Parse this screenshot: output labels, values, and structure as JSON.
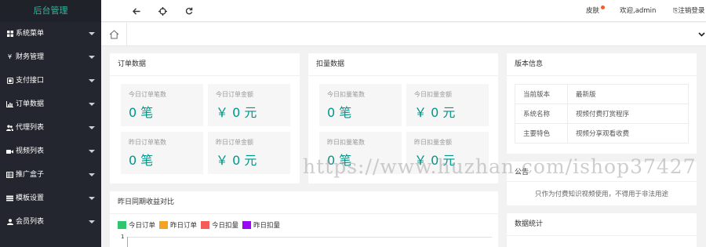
{
  "app": {
    "title": "后台管理"
  },
  "sidebar": {
    "items": [
      {
        "label": "系统菜单",
        "icon": "grid-icon"
      },
      {
        "label": "财务管理",
        "icon": "yen-icon"
      },
      {
        "label": "支付接口",
        "icon": "payment-icon"
      },
      {
        "label": "订单数据",
        "icon": "bar-chart-icon"
      },
      {
        "label": "代理列表",
        "icon": "users-icon"
      },
      {
        "label": "视频列表",
        "icon": "video-icon"
      },
      {
        "label": "推广盒子",
        "icon": "table-icon"
      },
      {
        "label": "模板设置",
        "icon": "layout-icon"
      },
      {
        "label": "会员列表",
        "icon": "user-icon"
      }
    ]
  },
  "header": {
    "skin_label": "皮肤",
    "welcome_text": "欢迎,admin",
    "logout_label": "注销登录"
  },
  "order_card": {
    "title": "订单数据",
    "stats": [
      {
        "label": "今日订单笔数",
        "value": "0 笔"
      },
      {
        "label": "今日订单金额",
        "value": "￥ 0 元"
      },
      {
        "label": "昨日订单笔数",
        "value": "0 笔"
      },
      {
        "label": "昨日订单金额",
        "value": "￥ 0 元"
      }
    ]
  },
  "deduct_card": {
    "title": "扣量数据",
    "stats": [
      {
        "label": "今日扣量笔数",
        "value": "0 笔"
      },
      {
        "label": "今日扣量金额",
        "value": "￥ 0 元"
      },
      {
        "label": "昨日扣量笔数",
        "value": "0 笔"
      },
      {
        "label": "昨日扣量金额",
        "value": "￥ 0 元"
      }
    ]
  },
  "version_card": {
    "title": "版本信息",
    "rows": [
      {
        "key": "当前版本",
        "value": "最新版"
      },
      {
        "key": "系统名称",
        "value": "视频付费打赏程序"
      },
      {
        "key": "主要特色",
        "value": "视频分享观看收费"
      }
    ]
  },
  "notice_card": {
    "title": "公告",
    "text": "只作为付费知识视频使用，不得用于非法用途"
  },
  "stats_card": {
    "title": "数据统计"
  },
  "chart_card": {
    "title": "昨日同期收益对比",
    "first_tick": "1"
  },
  "chart_data": {
    "type": "bar",
    "title": "昨日同期收益对比",
    "series": [
      {
        "name": "今日订单",
        "color": "#2ec770"
      },
      {
        "name": "昨日订单",
        "color": "#f4a322"
      },
      {
        "name": "今日扣量",
        "color": "#f45b5b"
      },
      {
        "name": "昨日扣量",
        "color": "#9b08f5"
      }
    ],
    "y_ticks": [
      "1"
    ]
  },
  "watermark": "https://www.huzhan.com/ishop37427"
}
